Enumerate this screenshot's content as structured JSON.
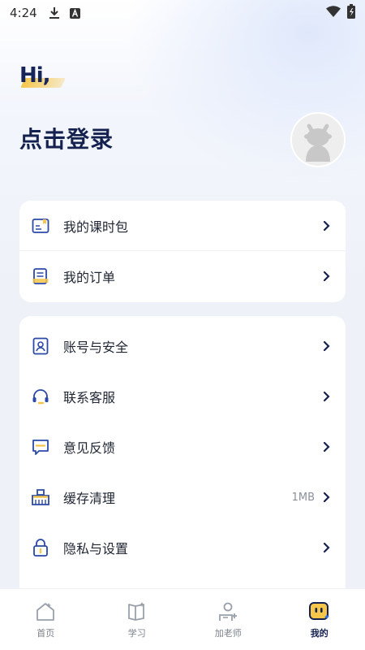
{
  "status_bar": {
    "time": "4:24",
    "icons": [
      "download-icon",
      "font-a-icon",
      "wifi-icon",
      "battery-icon"
    ]
  },
  "header": {
    "greeting": "Hi,",
    "login_prompt": "点击登录"
  },
  "menu_group_1": {
    "items": [
      {
        "label": "我的课时包",
        "icon": "lesson-package-icon"
      },
      {
        "label": "我的订单",
        "icon": "order-icon"
      }
    ]
  },
  "menu_group_2": {
    "items": [
      {
        "label": "账号与安全",
        "icon": "account-icon"
      },
      {
        "label": "联系客服",
        "icon": "headset-icon"
      },
      {
        "label": "意见反馈",
        "icon": "feedback-icon"
      },
      {
        "label": "缓存清理",
        "icon": "broom-icon",
        "value": "1MB"
      },
      {
        "label": "隐私与设置",
        "icon": "lock-icon"
      }
    ]
  },
  "tab_bar": {
    "tabs": [
      {
        "label": "首页",
        "icon": "home-icon"
      },
      {
        "label": "学习",
        "icon": "book-icon"
      },
      {
        "label": "加老师",
        "icon": "add-teacher-icon"
      },
      {
        "label": "我的",
        "icon": "profile-icon",
        "active": true
      }
    ]
  },
  "colors": {
    "primary_navy": "#15224f",
    "accent_yellow": "#f5c64a",
    "icon_blue": "#2b4aa8"
  }
}
